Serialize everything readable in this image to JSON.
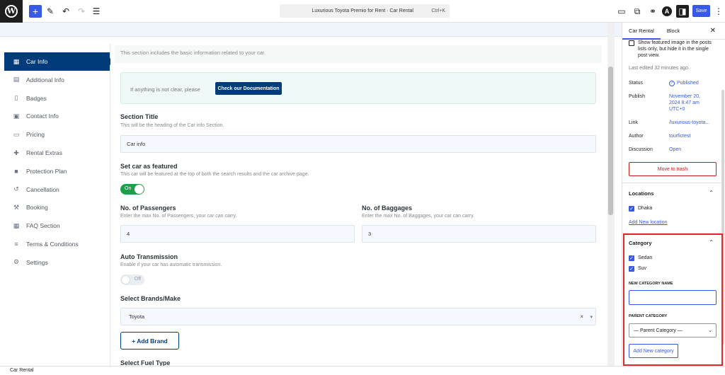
{
  "topbar": {
    "doc_title": "Luxurious Toyota Premio for Rent · Car Rental",
    "shortcut": "Ctrl+K",
    "save_label": "Save"
  },
  "nav": {
    "items": [
      {
        "label": "Car Info",
        "icon": "calendar-icon",
        "active": true
      },
      {
        "label": "Additional Info",
        "icon": "clipboard-icon"
      },
      {
        "label": "Badges",
        "icon": "document-icon"
      },
      {
        "label": "Contact Info",
        "icon": "contact-card-icon"
      },
      {
        "label": "Pricing",
        "icon": "credit-card-icon"
      },
      {
        "label": "Rental Extras",
        "icon": "tools-icon"
      },
      {
        "label": "Protection Plan",
        "icon": "lock-icon"
      },
      {
        "label": "Cancellation",
        "icon": "undo-icon"
      },
      {
        "label": "Booking",
        "icon": "hammer-icon"
      },
      {
        "label": "FAQ Section",
        "icon": "calendar-icon"
      },
      {
        "label": "Terms & Conditions",
        "icon": "list-icon"
      },
      {
        "label": "Settings",
        "icon": "gears-icon"
      }
    ],
    "accent": "#003c79"
  },
  "main": {
    "intro": "This section includes the basic information related to your car.",
    "doc_text": "If anything is not clear, please",
    "doc_button": "Check our Documentation",
    "section_title": {
      "label": "Section Title",
      "desc": "This will be the heading of the Car info Section.",
      "value": "Car info"
    },
    "featured": {
      "label": "Set car as featured",
      "desc": "This car will be featured at the top of both the search results and the car archive page.",
      "toggle": "On"
    },
    "passengers": {
      "label": "No. of Passengers",
      "desc": "Enter the max No. of Passengers, your car can carry.",
      "value": "4"
    },
    "baggages": {
      "label": "No. of Baggages",
      "desc": "Enter the max No. of Baggages, your car can carry.",
      "value": "3"
    },
    "transmission": {
      "label": "Auto Transmission",
      "desc": "Enable if your car has automatic transmission.",
      "toggle": "Off"
    },
    "brands": {
      "label": "Select Brands/Make",
      "value": "Toyota",
      "clear": "×",
      "caret": "▾"
    },
    "add_brand": "+  Add Brand",
    "fuel_label": "Select Fuel Type"
  },
  "sidebar": {
    "tabs": [
      "Car Rental",
      "Block"
    ],
    "featured_note": "Show featured image in the posts lists only, but hide it in the single post view.",
    "last_edited": "Last edited 32 minutes ago.",
    "rows": [
      {
        "key": "Status",
        "value": "Published"
      },
      {
        "key": "Publish",
        "value": "November 20, 2024 8:47 am UTC+0"
      },
      {
        "key": "Link",
        "value": "/luxurious-toyota..."
      },
      {
        "key": "Author",
        "value": "tourfictest"
      },
      {
        "key": "Discussion",
        "value": "Open"
      }
    ],
    "trash": "Move to trash",
    "locations": {
      "title": "Locations",
      "items": [
        "Dhaka"
      ],
      "add_link": "Add New location"
    },
    "category": {
      "title": "Category",
      "items": [
        "Sedan",
        "Suv"
      ],
      "new_label": "NEW CATEGORY NAME",
      "new_value": "",
      "parent_label": "PARENT CATEGORY",
      "parent_value": "— Parent Category —",
      "add_button": "Add New category"
    }
  },
  "footer": {
    "breadcrumb": "Car Rental"
  }
}
